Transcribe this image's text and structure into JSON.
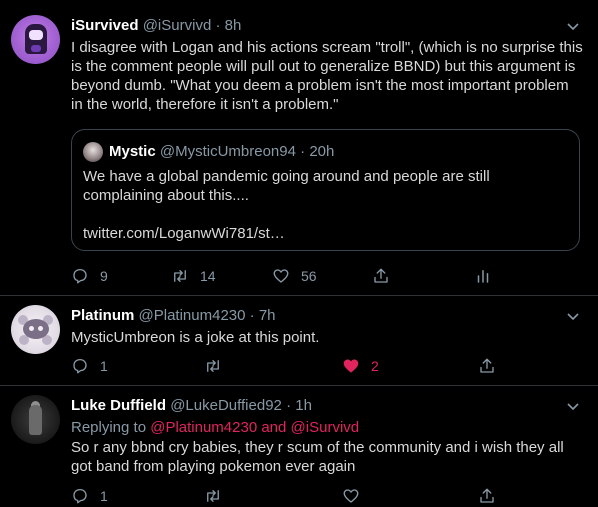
{
  "colors": {
    "background": "#000000",
    "text": "#d9d9d9",
    "muted": "#8899a6",
    "accent_like": "#e0245e",
    "border": "#2f3336"
  },
  "tweets": [
    {
      "name": "iSurvived",
      "handle": "@iSurvivd",
      "sep": "·",
      "time": "8h",
      "text": "I disagree with Logan and his actions scream \"troll\", (which is no surprise this is the comment people will pull out to generalize BBND) but this argument is beyond dumb. \"What you deem a problem isn't the most important problem in the world, therefore it isn't a problem.\"",
      "quote": {
        "name": "Mystic",
        "handle": "@MysticUmbreon94",
        "sep": "·",
        "time": "20h",
        "text": "We have a global pandemic going around and people are still complaining about this....",
        "link": "twitter.com/LoganwWi781/st…"
      },
      "counts": {
        "reply": "9",
        "retweet": "14",
        "like": "56"
      },
      "icons": [
        "reply-icon",
        "retweet-icon",
        "like-icon",
        "share-icon",
        "analytics-icon"
      ]
    },
    {
      "name": "Platinum",
      "handle": "@Platinum4230",
      "sep": "·",
      "time": "7h",
      "text": "MysticUmbreon is a joke at this point.",
      "counts": {
        "reply": "1",
        "retweet": "",
        "like": "2"
      },
      "liked": true
    },
    {
      "name": "Luke Duffield",
      "handle": "@LukeDuffied92",
      "sep": "·",
      "time": "1h",
      "replying_prefix": "Replying to ",
      "replying_to": "@Platinum4230 and @iSurvivd",
      "text": "So r any bbnd cry babies, they r scum of the community and i wish they all got band from playing pokemon ever again",
      "counts": {
        "reply": "1",
        "retweet": "",
        "like": ""
      }
    }
  ]
}
